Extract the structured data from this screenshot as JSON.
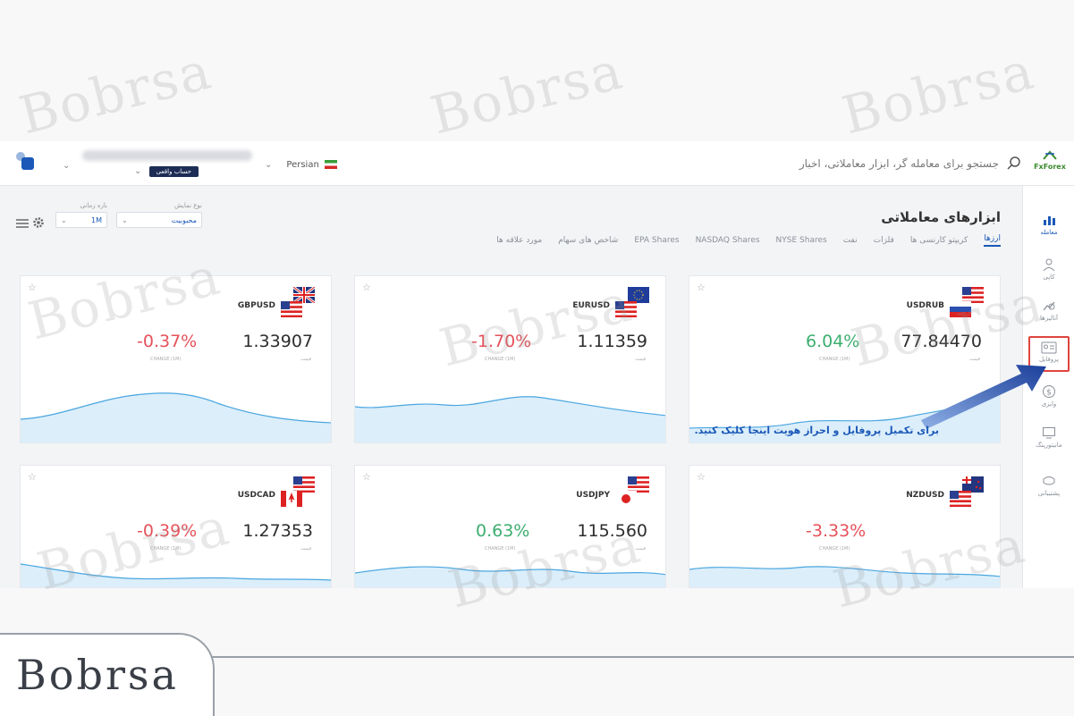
{
  "watermark": "Bobrsa",
  "brand": {
    "name": "FxForex"
  },
  "search": {
    "placeholder": "جستجو برای معامله گر، ابزار معاملاتی، اخبار"
  },
  "language": {
    "label": "Persian"
  },
  "account": {
    "badge": "حساب واقعی"
  },
  "page": {
    "title": "ابزارهای معاملاتی"
  },
  "tabs": [
    {
      "label": "ارزها",
      "active": true
    },
    {
      "label": "کریپتو کارنسی ها",
      "active": false
    },
    {
      "label": "فلزات",
      "active": false
    },
    {
      "label": "نفت",
      "active": false
    },
    {
      "label": "NYSE Shares",
      "active": false
    },
    {
      "label": "NASDAQ Shares",
      "active": false
    },
    {
      "label": "EPA Shares",
      "active": false
    },
    {
      "label": "شاخص های سهام",
      "active": false
    },
    {
      "label": "مورد علاقه ها",
      "active": false
    }
  ],
  "filters": {
    "sort": {
      "label": "نوع نمایش",
      "value": "محبوبیت"
    },
    "period": {
      "label": "بازه زمانی",
      "value": "1M"
    }
  },
  "nav": [
    {
      "label": "معامله",
      "icon": "chart-icon"
    },
    {
      "label": "کاپی",
      "icon": "user-icon"
    },
    {
      "label": "آنالیزها",
      "icon": "analysis-icon"
    },
    {
      "label": "پروفایل",
      "icon": "profile-card-icon"
    },
    {
      "label": "وایزی",
      "icon": "dollar-icon"
    },
    {
      "label": "مانیتورینگ",
      "icon": "monitor-icon"
    },
    {
      "label": "پشتیبانی",
      "icon": "support-icon"
    }
  ],
  "cards": [
    {
      "symbol": "USDRUB",
      "price": "77.84470",
      "change": "6.04%",
      "direction": "up",
      "price_caption": "قیمت",
      "change_caption": "CHANGE (1M)"
    },
    {
      "symbol": "EURUSD",
      "price": "1.11359",
      "change": "-1.70%",
      "direction": "down",
      "price_caption": "قیمت",
      "change_caption": "CHANGE (1M)"
    },
    {
      "symbol": "GBPUSD",
      "price": "1.33907",
      "change": "-0.37%",
      "direction": "down",
      "price_caption": "قیمت",
      "change_caption": "CHANGE (1M)"
    },
    {
      "symbol": "NZDUSD",
      "price": "",
      "change": "-3.33%",
      "direction": "down",
      "price_caption": "",
      "change_caption": "CHANGE (1M)"
    },
    {
      "symbol": "USDJPY",
      "price": "115.560",
      "change": "0.63%",
      "direction": "up",
      "price_caption": "قیمت",
      "change_caption": "CHANGE (1M)"
    },
    {
      "symbol": "USDCAD",
      "price": "1.27353",
      "change": "-0.39%",
      "direction": "down",
      "price_caption": "قیمت",
      "change_caption": "CHANGE (1M)"
    }
  ],
  "annotation": {
    "text": "برای تکمیل پروفایل و احراز هویت اینجا کلیک کنید."
  },
  "logo": {
    "text": "Bobrsa"
  },
  "colors": {
    "accent": "#1b58b8",
    "negative": "#e5525b",
    "positive": "#3cae6f",
    "highlight": "#e0443e"
  }
}
